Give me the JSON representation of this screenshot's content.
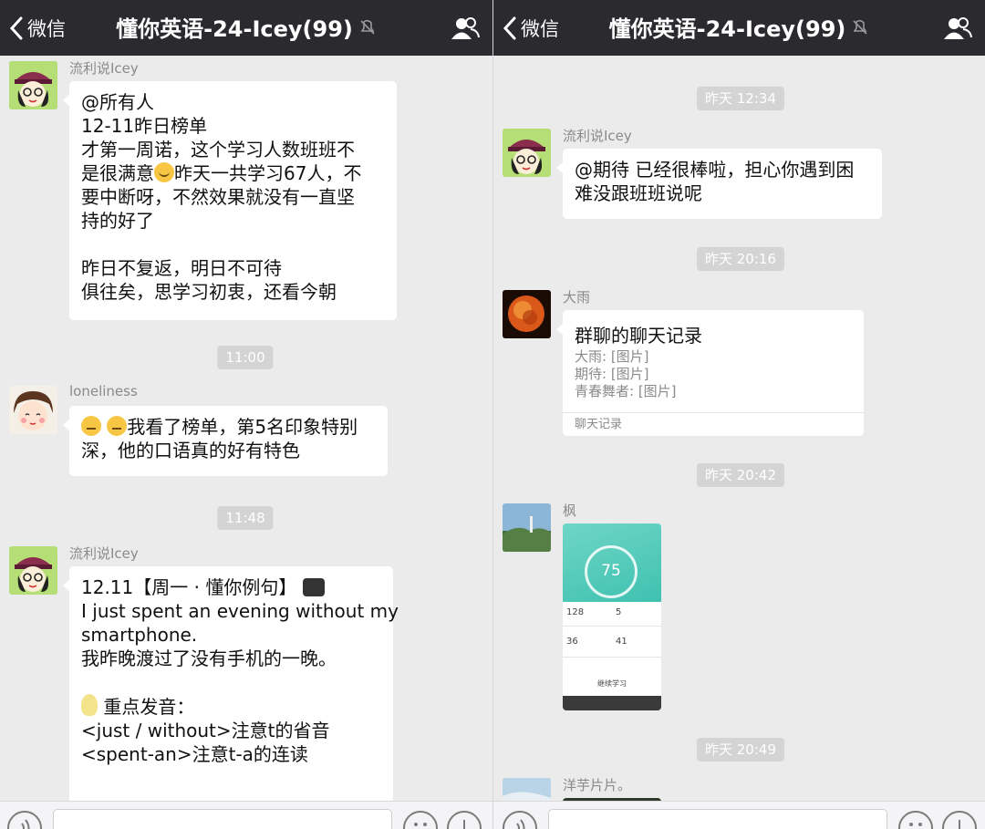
{
  "left": {
    "nav": {
      "back_label": "微信",
      "title": "懂你英语-24-Icey(99)"
    },
    "messages": [
      {
        "sender": "流利说Icey",
        "lines": [
          "@所有人",
          "12-11昨日榜单",
          "才第一周诺，这个学习人数班班不",
          "是很满意",
          "昨天一共学习67人，不",
          "要中断呀，不然效果就没有一直坚",
          "持的好了",
          "",
          "昨日不复返，明日不可待",
          "俱往矣，思学习初衷，还看今朝"
        ]
      },
      {
        "sender": "loneliness",
        "lines": [
          "我看了榜单，第5名印象特别",
          "深，他的口语真的好有特色"
        ]
      },
      {
        "sender": "流利说Icey",
        "lines": [
          "12.11【周一 · 懂你例句】",
          "I just spent an evening without my",
          "smartphone.",
          "我昨晚渡过了没有手机的一晚。",
          "",
          "重点发音：",
          "<just / without>注意t的省音",
          "<spent-an>注意t-a的连读"
        ]
      }
    ],
    "times": [
      "11:00",
      "11:48"
    ]
  },
  "right": {
    "nav": {
      "back_label": "微信",
      "title": "懂你英语-24-Icey(99)"
    },
    "times": [
      "昨天 12:34",
      "昨天 20:16",
      "昨天 20:42",
      "昨天 20:49"
    ],
    "messages": [
      {
        "sender": "流利说Icey",
        "lines": [
          "@期待 已经很棒啦，担心你遇到困",
          "难没跟班班说呢"
        ]
      },
      {
        "sender": "大雨",
        "card": {
          "title": "群聊的聊天记录",
          "items": [
            "大雨: [图片]",
            "期待: [图片]",
            "青春舞者: [图片]"
          ],
          "footer": "聊天记录"
        }
      },
      {
        "sender": "枫",
        "image": {
          "score": "75",
          "stats": [
            "128",
            "5",
            "36",
            "41"
          ],
          "button": "继续学习"
        }
      },
      {
        "sender": "洋芋片片。"
      }
    ]
  },
  "colors": {
    "navbar": "#2b2b2f",
    "background": "#ebebeb",
    "bubble": "#ffffff",
    "timestamp": "#d4d4d4"
  },
  "icons": [
    "chevron-left-icon",
    "mute-icon",
    "group-members-icon",
    "voice-icon",
    "emoji-icon",
    "plus-icon"
  ]
}
